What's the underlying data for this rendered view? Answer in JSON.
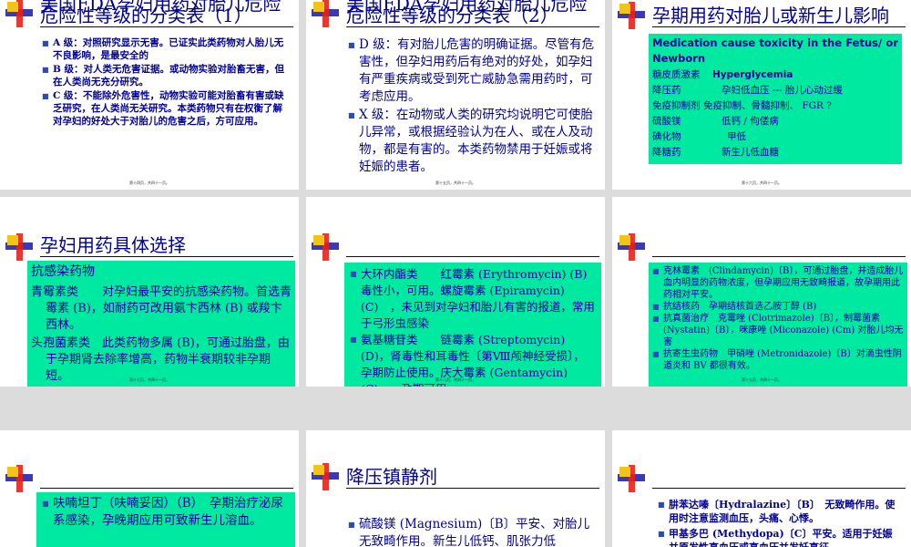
{
  "slides": {
    "s1": {
      "title_line1": "美国FDA孕妇用药对胎儿危险",
      "title_line2": "危险性等级的分类表（1）",
      "items": [
        "A 级：对照研究显示无害。已证实此类药物对人胎儿无不良影响，是最安全的",
        "B 级：对人类无危害证据。或动物实验对胎畜无害，但在人类尚无充分研究。",
        "C 级：不能除外危害性，动物实验可能对胎畜有害或缺乏研究，在人类尚无关研究。本类药物只有在权衡了解对孕妇的好处大于对胎儿的危害之后，方可应用。"
      ],
      "page": "第十四页，共四十一页。"
    },
    "s2": {
      "title_line1": "美国FDA孕妇用药对胎儿危险",
      "title_line2": "危险性等级的分类表（2）",
      "items": [
        "D 级：有对胎儿危害的明确证据。尽管有危害性，但孕妇用药后有绝对的好处，如孕妇有严重疾病或受到死亡威胁急需用药时，可考虑应用。",
        "X 级：在动物或人类的研究均说明它可使胎儿异常，或根据经验认为在人、或在人及动物，都是有害的。本类药物禁用于妊娠或将妊娠的患者。"
      ],
      "page": "第十五页，共四十一页。"
    },
    "s3": {
      "title": "孕期用药对胎儿或新生儿影响",
      "header": "Medication cause toxicity in the Fetus/ or Newborn",
      "rows": [
        {
          "drug": "糖皮质激素",
          "effect": "Hyperglycemia"
        },
        {
          "drug": "降压药",
          "effect": "孕妇低血压 --- 胎儿心动过缓"
        },
        {
          "drug": "免疫抑制剂",
          "effect": "免疫抑制、骨髓抑制、 FGR ?"
        },
        {
          "drug": "硫酸镁",
          "effect": "低钙 / 佝偻病"
        },
        {
          "drug": "碘化物",
          "effect": "甲低"
        },
        {
          "drug": "降糖药",
          "effect": "新生儿低血糖"
        }
      ],
      "page": "第十六页，共四十一页。"
    },
    "s4": {
      "title": "孕妇用药具体选择",
      "heading": "抗感染药物",
      "para1": "青霉素类　　对孕妇最平安的抗感染药物。首选青霉素 (B)，如耐药可改用氨卞西林 (B) 或羧卞西林。",
      "para2": "头孢菌素类　此类药物多属 (B)，可通过胎盘，由于孕期肾去除率增高，药物半衰期较非孕期短。",
      "page": "第十七页，共四十一页。"
    },
    "s5": {
      "items": [
        "大环内酯类　　红霉素 (Erythromycin) (B)　毒性小，可用。螺旋霉素 (Epiramycin) (C)　，未见到对孕妇和胎儿有害的报道，常用于弓形虫感染",
        "氨基糖苷类　　链霉素 (Streptomycin) (D)，肾毒性和耳毒性〔第Ⅷ颅神经受损〕，孕期防止使用。庆大霉素 (Gentamycin) (C)　，孕期可用。"
      ],
      "page": "第十八页，共四十一页。"
    },
    "s6": {
      "items": [
        "克林霉素　(Clindamycin)〔B〕，可通过胎盘，并造成胎儿血内明显的药物浓度，但孕期应用无致畸报道，故孕期用此药相对平安。",
        "抗结核药　孕期结核首选乙胺丁醇 (B)",
        "抗真菌治疗　克霉唑 (Clotrimazole)〔B〕，制霉菌素 (Nystatin)〔B〕，咪康唑 (Miconazole) (Cm) 对胎儿均无害",
        "抗寄生虫药物　甲硝唑 (Metronidazole)〔B〕对滴虫性阴道炎和 BV 都很有效。"
      ],
      "page": "第十九页，共四十一页。"
    },
    "s7": {
      "items": [
        "呋喃坦丁（呋喃妥因）（B）　孕期治疗泌尿系感染，孕晚期应用可致新生儿溶血。"
      ]
    },
    "s8": {
      "title": "降压镇静剂",
      "items": [
        "硫酸镁 (Magnesium)〔B〕平安、对胎儿无致畸作用。新生儿低钙、肌张力低"
      ]
    },
    "s9": {
      "items": [
        "肼苯达嗪〔Hydralazine〕〔B〕　无致畸作用。使用时注意监测血压，头痛、心悸。",
        "甲基多巴 (Methydopa)〔C〕平安。适用于妊娠并原发性高血压或高血压并发妊高征"
      ]
    }
  }
}
